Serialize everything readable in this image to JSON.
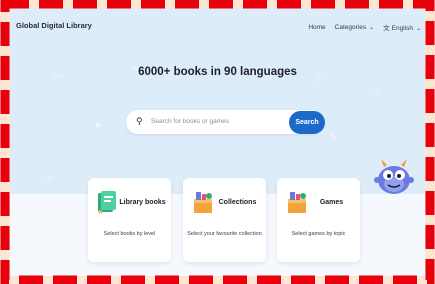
{
  "header": {
    "brand": "Global Digital Library",
    "nav": [
      {
        "label": "Home"
      },
      {
        "label": "Categories"
      },
      {
        "label": "English"
      }
    ]
  },
  "hero": {
    "title": "6000+ books in 90 languages"
  },
  "search": {
    "placeholder": "Search for books or games",
    "button": "Search"
  },
  "cards": [
    {
      "title": "Library books",
      "description": "Select books by level",
      "icon": "green-book-icon"
    },
    {
      "title": "Collections",
      "description": "Select your favourite collection",
      "icon": "box-icon"
    },
    {
      "title": "Games",
      "description": "Select games by topic",
      "icon": "box-icon"
    }
  ],
  "colors": {
    "frame_dash": "#e8000c",
    "frame_bg": "#fbe7d3",
    "hero_bg": "#dcecf8",
    "search_button": "#1b69c9"
  }
}
